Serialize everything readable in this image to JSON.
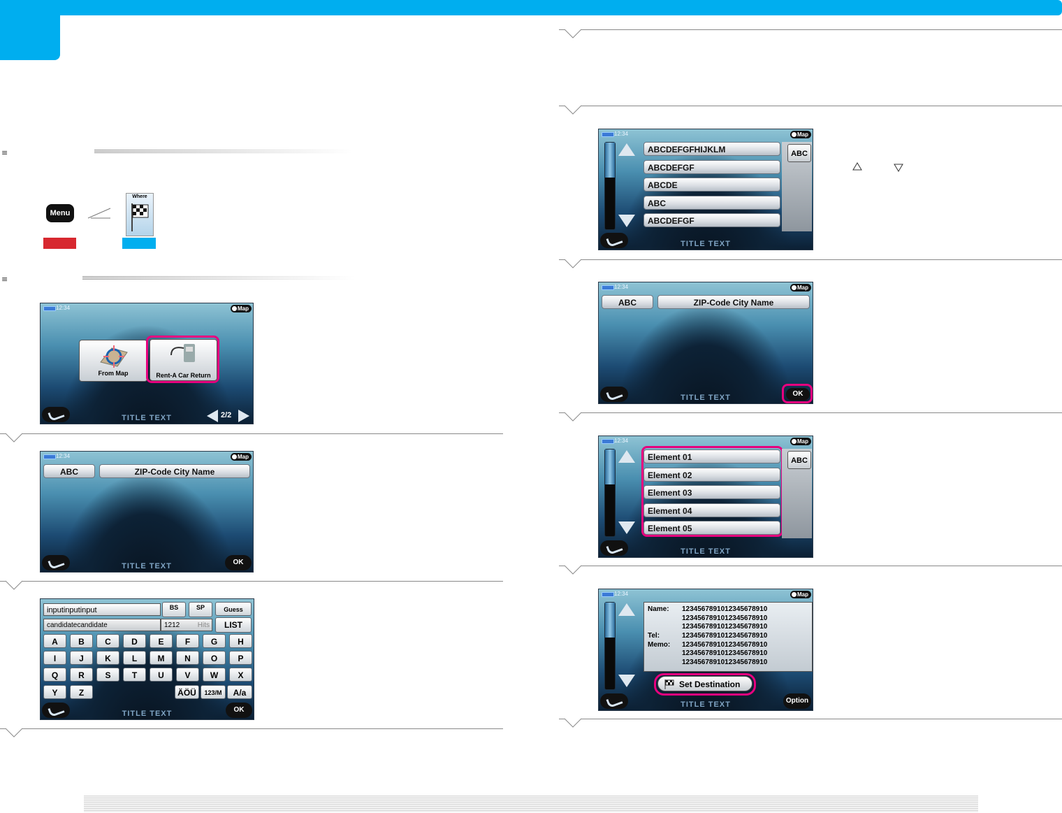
{
  "menu_button_label": "Menu",
  "where_icon_label": "Where",
  "common": {
    "title_text": "TITLE TEXT",
    "time": "12:34",
    "map": "Map",
    "ok": "OK",
    "option": "Option",
    "abc": "ABC",
    "zip": "ZIP-Code City Name"
  },
  "screen1": {
    "from_map": "From Map",
    "rent_a_car_return": "Rent-A Car Return",
    "page": "2/2"
  },
  "keyboard": {
    "input": "inputinputinput",
    "candidate": "candidatecandidate",
    "hits_count": "1212",
    "hits_label": "Hits",
    "bs": "BS",
    "sp": "SP",
    "guess": "Guess",
    "list": "LIST",
    "row1": [
      "A",
      "B",
      "C",
      "D",
      "E",
      "F",
      "G",
      "H"
    ],
    "row2": [
      "I",
      "J",
      "K",
      "L",
      "M",
      "N",
      "O",
      "P"
    ],
    "row3": [
      "Q",
      "R",
      "S",
      "T",
      "U",
      "V",
      "W",
      "X"
    ],
    "row4": [
      "Y",
      "Z"
    ],
    "umlaut": "ÄÖÜ",
    "num": "123/M",
    "case": "A/a"
  },
  "list_abc": [
    "ABCDEFGFHIJKLM",
    "ABCDEFGF",
    "ABCDE",
    "ABC",
    "ABCDEFGF"
  ],
  "list_elements": [
    "Element 01",
    "Element 02",
    "Element 03",
    "Element 04",
    "Element 05"
  ],
  "details": {
    "name_label": "Name:",
    "tel_label": "Tel:",
    "memo_label": "Memo:",
    "lines": [
      "1234567891012345678910",
      "1234567891012345678910",
      "1234567891012345678910",
      "1234567891012345678910",
      "1234567891012345678910",
      "1234567891012345678910",
      "1234567891012345678910"
    ],
    "set_destination": "Set Destination"
  }
}
